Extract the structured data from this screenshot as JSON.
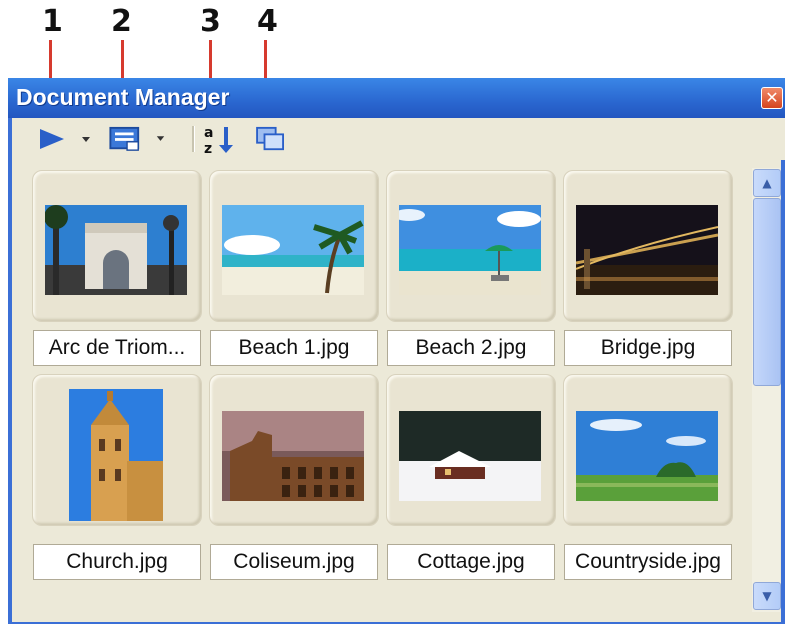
{
  "callouts": [
    "1",
    "2",
    "3",
    "4"
  ],
  "window": {
    "title": "Document Manager",
    "close_glyph": "✕"
  },
  "toolbar": {
    "play_icon": "play-icon",
    "view_icon": "view-mode-icon",
    "sort_icon": "sort-az-icon",
    "duplicate_icon": "duplicate-window-icon",
    "sort_label": "a z"
  },
  "scrollbar": {
    "up_glyph": "▲",
    "down_glyph": "▼"
  },
  "documents": [
    {
      "name": "Arc de Triom..."
    },
    {
      "name": "Beach 1.jpg"
    },
    {
      "name": "Beach 2.jpg"
    },
    {
      "name": "Bridge.jpg"
    },
    {
      "name": "Church.jpg"
    },
    {
      "name": "Coliseum.jpg"
    },
    {
      "name": "Cottage.jpg"
    },
    {
      "name": "Countryside.jpg"
    }
  ],
  "colors": {
    "titlebar": "#2a67d0",
    "callout_line": "#d63a2e",
    "panel": "#ece9d8"
  }
}
